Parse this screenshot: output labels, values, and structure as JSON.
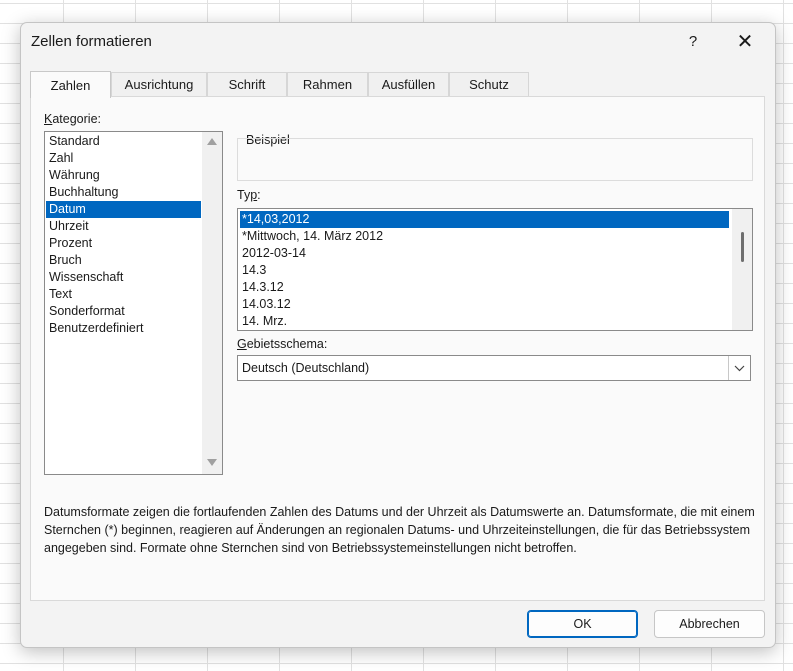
{
  "window": {
    "title": "Zellen formatieren",
    "help_label": "?",
    "close_label": "✕"
  },
  "tabs": [
    {
      "label": "Zahlen",
      "active": true
    },
    {
      "label": "Ausrichtung",
      "active": false
    },
    {
      "label": "Schrift",
      "active": false
    },
    {
      "label": "Rahmen",
      "active": false
    },
    {
      "label": "Ausfüllen",
      "active": false
    },
    {
      "label": "Schutz",
      "active": false
    }
  ],
  "category": {
    "label_underlined": "K",
    "label_rest": "ategorie:",
    "items": [
      "Standard",
      "Zahl",
      "Währung",
      "Buchhaltung",
      "Datum",
      "Uhrzeit",
      "Prozent",
      "Bruch",
      "Wissenschaft",
      "Text",
      "Sonderformat",
      "Benutzerdefiniert"
    ],
    "selected": "Datum"
  },
  "sample": {
    "label": "Beispiel"
  },
  "type": {
    "label_pre": "Ty",
    "label_underlined": "p",
    "label_post": ":",
    "items": [
      "*14,03,2012",
      "*Mittwoch, 14. März 2012",
      "2012-03-14",
      "14.3",
      "14.3.12",
      "14.03.12",
      "14. Mrz."
    ],
    "selected": "*14,03,2012"
  },
  "locale": {
    "label_underlined": "G",
    "label_rest": "ebietsschema:",
    "value": "Deutsch (Deutschland)",
    "dropdown_icon": "chevron-down"
  },
  "description": "Datumsformate zeigen die fortlaufenden Zahlen des Datums und der Uhrzeit als Datumswerte an. Datumsformate, die mit einem Sternchen (*) beginnen, reagieren auf Änderungen an regionalen Datums- und Uhrzeiteinstellungen, die für das Betriebssystem angegeben sind. Formate ohne Sternchen sind von Betriebssystemeinstellungen nicht betroffen.",
  "buttons": {
    "ok": "OK",
    "cancel": "Abbrechen"
  },
  "colors": {
    "selection": "#0067c0",
    "dialog_bg": "#f3f3f3",
    "panel_bg": "#fafafa"
  }
}
